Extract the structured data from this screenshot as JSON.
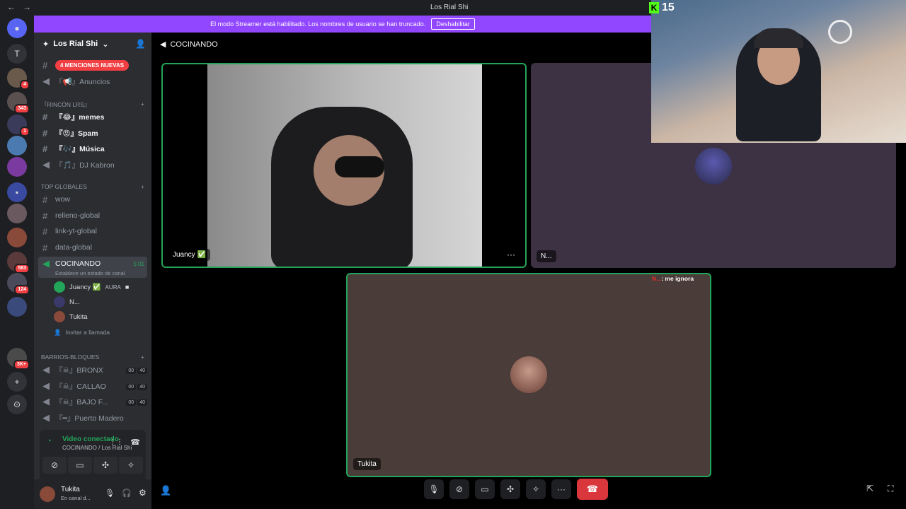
{
  "window": {
    "title": "Los Rial Shi"
  },
  "banner": {
    "text": "El modo Streamer está habilitado. Los nombres de usuario se han truncado.",
    "button": "Deshabilitar"
  },
  "overlay": {
    "kick_count": "15"
  },
  "rail": {
    "badges": [
      "3",
      "4",
      "343",
      "1",
      "583",
      "124",
      "3K+"
    ],
    "top_letter": "T"
  },
  "guild": {
    "name": "Los Rial Shi"
  },
  "channels": {
    "mentions_pill": "4 MENCIONES NUEVAS",
    "anuncios": "『📢』Anuncios",
    "cat_rincon": "『RINCÓN LRS』",
    "memes": "『😂』memes",
    "spam": "『😡』Spam",
    "musica": "『🎶』Música",
    "dj": "『🎵』DJ Kabron",
    "cat_top": "TOP GLOBALES",
    "wow": "wow",
    "relleno": "relleno-global",
    "link": "link-yt-global",
    "data": "data-global",
    "cocinando": "COCINANDO",
    "cocinando_time": "5:01",
    "cocinando_status": "Establece un estado de canal",
    "user1": "Juancy ✅",
    "user1_tag": "AURA",
    "user2": "N...",
    "user3": "Tukita",
    "invite": "Invitar a llamada",
    "cat_barrios": "BARRIOS-BLOQUES",
    "bronx": "『☠』BRONX",
    "callao": "『☠』CALLAO",
    "bajo": "『☠』BAJO F...",
    "puerto": "『━』Puerto Madero",
    "counts": [
      "00",
      "40"
    ]
  },
  "voice": {
    "status": "Video conectado",
    "sub": "COCINANDO / Los Rial Shi"
  },
  "userbar": {
    "name": "Tukita",
    "status": "En canal d..."
  },
  "main": {
    "channel": "COCINANDO",
    "tile1_name": "Juancy ✅",
    "tile2_name": "N...",
    "tile3_name": "Tukita",
    "chat_user": "N...",
    "chat_text": ": me ignora"
  }
}
